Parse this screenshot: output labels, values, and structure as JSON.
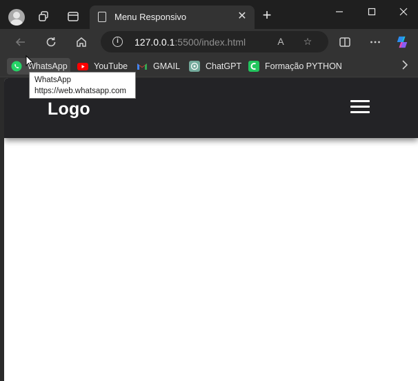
{
  "tab": {
    "title": "Menu Responsivo"
  },
  "addressbar": {
    "host": "127.0.0.1",
    "rest": ":5500/index.html"
  },
  "bookmarks": [
    {
      "label": "WhatsApp",
      "icon": "whatsapp-icon"
    },
    {
      "label": "YouTube",
      "icon": "youtube-icon"
    },
    {
      "label": "GMAIL",
      "icon": "gmail-icon"
    },
    {
      "label": "ChatGPT",
      "icon": "chatgpt-icon"
    },
    {
      "label": "Formação PYTHON",
      "icon": "python-course-icon"
    }
  ],
  "tooltip": {
    "title": "WhatsApp",
    "url": "https://web.whatsapp.com"
  },
  "site": {
    "logo": "Logo"
  },
  "colors": {
    "header_bg": "#232326",
    "browser_bg": "#333333",
    "whatsapp": "#25d366",
    "youtube": "#ff0000",
    "chatgpt": "#74aa9c",
    "python_course": "#22c55e"
  }
}
